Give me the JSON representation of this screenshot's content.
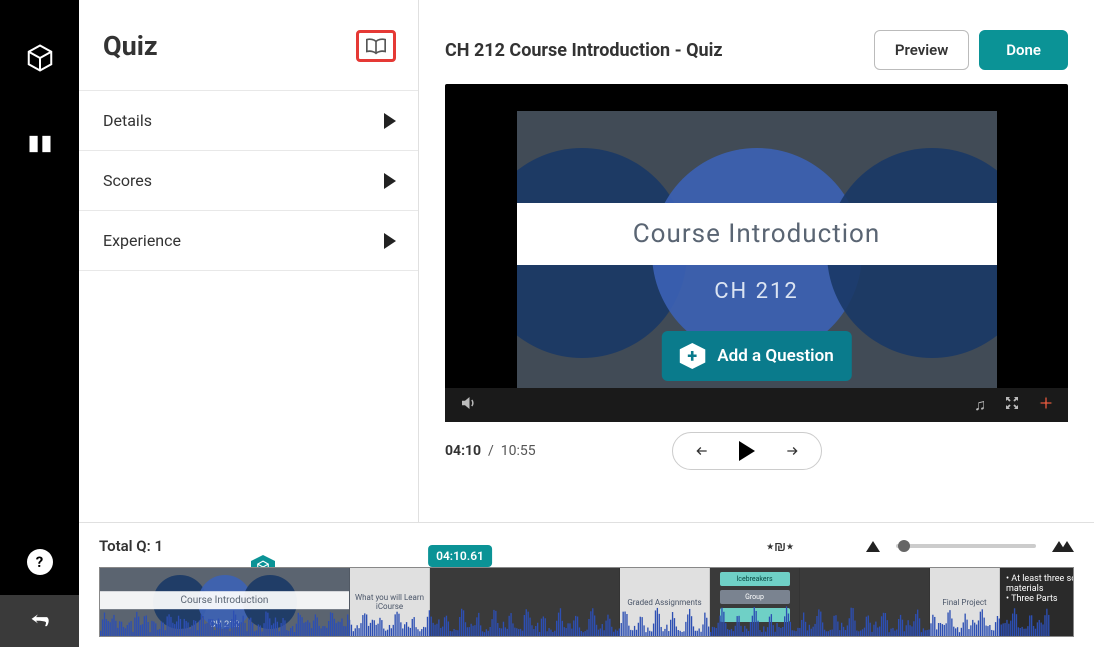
{
  "sidebar": {
    "title": "Quiz",
    "items": [
      {
        "label": "Details"
      },
      {
        "label": "Scores"
      },
      {
        "label": "Experience"
      }
    ]
  },
  "preview": {
    "title": "CH 212 Course Introduction - Quiz",
    "buttons": {
      "preview": "Preview",
      "done": "Done"
    },
    "slide_title": "Course Introduction",
    "slide_subtitle": "CH 212",
    "add_question": "Add a Question"
  },
  "transport": {
    "current": "04:10",
    "sep": "/",
    "total": "10:55"
  },
  "timeline": {
    "total_q_label": "Total Q:",
    "total_q": "1",
    "playhead": "04:10.61",
    "thumbs": {
      "t1": "Course Introduction",
      "t2": "What you will Learn iCourse",
      "t4": "Graded Assignments",
      "t5a": "Icebreakers",
      "t5b": "Group",
      "t7": "Final Project",
      "t8": "• At least three sources from assigned course materials\n• Three Parts"
    }
  }
}
